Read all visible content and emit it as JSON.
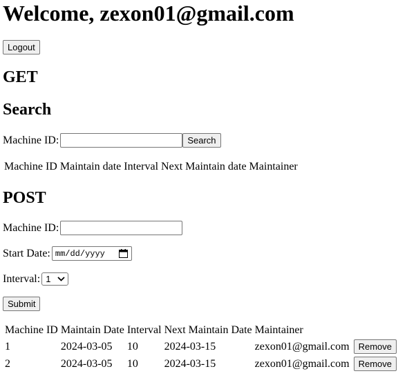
{
  "welcome": "Welcome, zexon01@gmail.com",
  "logout_label": "Logout",
  "get_section": {
    "heading": "GET",
    "search_heading": "Search",
    "machine_id_label": "Machine ID:",
    "machine_id_value": "",
    "search_button": "Search",
    "result_columns": [
      "Machine ID",
      "Maintain date",
      "Interval",
      "Next Maintain date",
      "Maintainer"
    ]
  },
  "post_section": {
    "heading": "POST",
    "machine_id_label": "Machine ID:",
    "machine_id_value": "",
    "start_date_label": "Start Date:",
    "start_date_placeholder": "mm/dd/yyyy",
    "interval_label": "Interval:",
    "interval_value": "1",
    "submit_button": "Submit"
  },
  "records_table": {
    "columns": [
      "Machine ID",
      "Maintain Date",
      "Interval",
      "Next Maintain Date",
      "Maintainer"
    ],
    "rows": [
      {
        "machine_id": "1",
        "maintain_date": "2024-03-05",
        "interval": "10",
        "next_maintain_date": "2024-03-15",
        "maintainer": "zexon01@gmail.com",
        "action": "Remove"
      },
      {
        "machine_id": "2",
        "maintain_date": "2024-03-05",
        "interval": "10",
        "next_maintain_date": "2024-03-15",
        "maintainer": "zexon01@gmail.com",
        "action": "Remove"
      }
    ]
  },
  "icons": {
    "calendar": "calendar-icon",
    "select_arrow": "chevron-down-icon"
  }
}
